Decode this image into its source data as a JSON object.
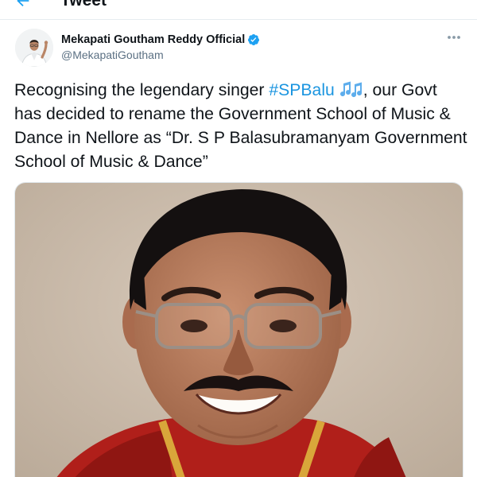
{
  "header": {
    "title": "Tweet"
  },
  "tweet": {
    "author": {
      "display_name": "Mekapati Goutham Reddy Official",
      "handle": "@MekapatiGoutham",
      "verified": true
    },
    "text_before": "Recognising the legendary singer ",
    "hashtag": "#SPBalu",
    "emoji": "musical-notes",
    "text_after": ", our Govt has decided to rename the Government School of Music & Dance in Nellore as “Dr. S P Balasubramanyam Government School of Music & Dance”",
    "media": {
      "type": "photo"
    }
  },
  "colors": {
    "link": "#1b95e0",
    "verified_badge": "#1da1f2",
    "secondary_text": "#5b7083"
  },
  "icons": [
    "back-arrow-icon",
    "verified-badge-icon",
    "more-options-icon",
    "musical-notes-emoji"
  ]
}
